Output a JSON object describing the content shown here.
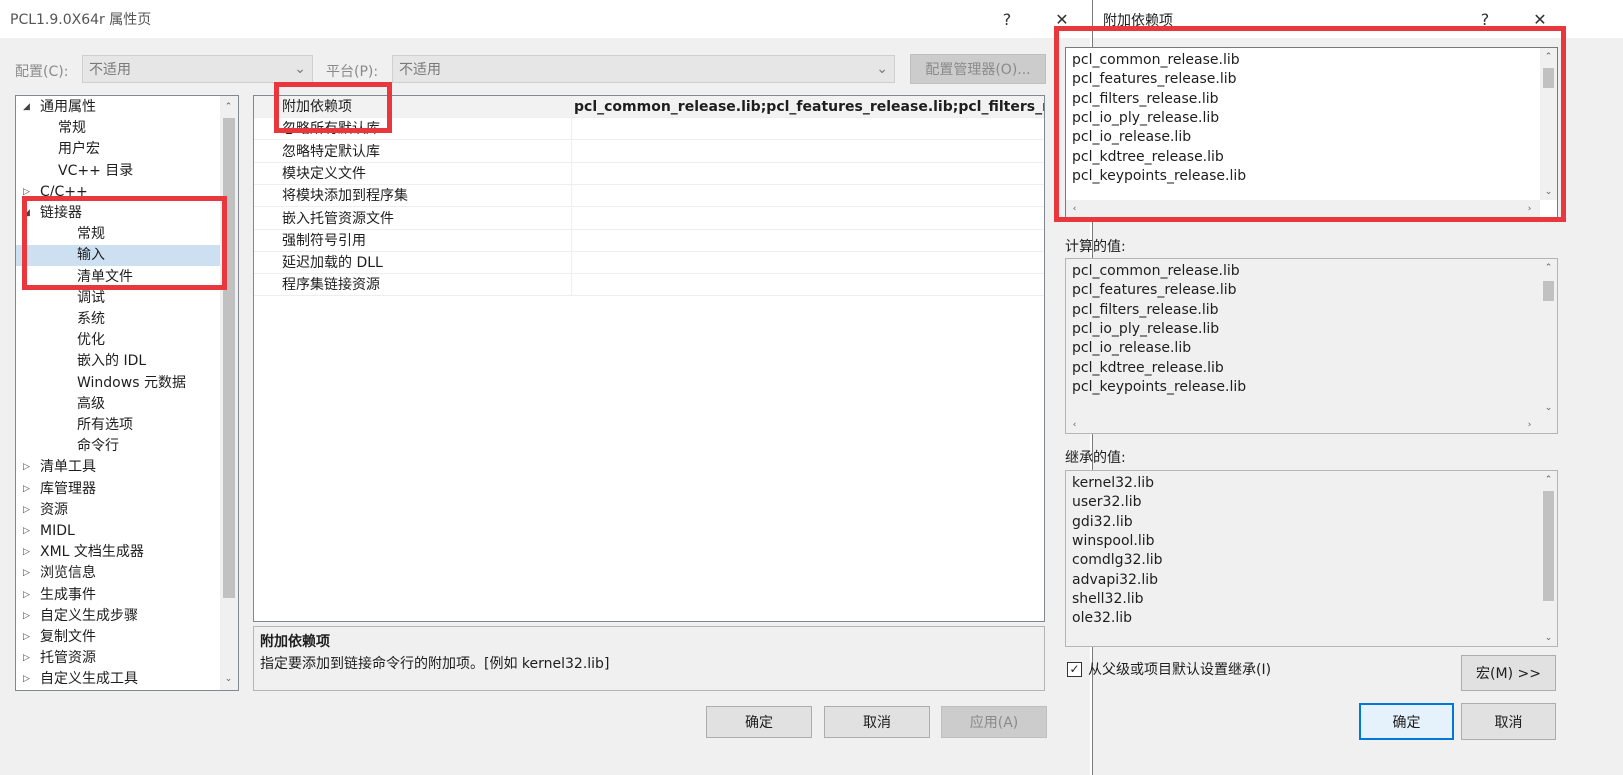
{
  "main_dialog": {
    "title": "PCL1.9.0X64r 属性页",
    "help_label": "?",
    "close_label": "✕",
    "config_label": "配置(C):",
    "config_value": "不适用",
    "platform_label": "平台(P):",
    "platform_value": "不适用",
    "config_manager_label": "配置管理器(O)...",
    "tree": [
      {
        "label": "通用属性",
        "arrow": "◢"
      },
      {
        "label": "常规",
        "arrow": ""
      },
      {
        "label": "用户宏",
        "arrow": ""
      },
      {
        "label": "VC++ 目录",
        "arrow": ""
      },
      {
        "label": "C/C++",
        "arrow": "▷"
      },
      {
        "label": "链接器",
        "arrow": "◢"
      },
      {
        "label": "常规",
        "arrow": ""
      },
      {
        "label": "输入",
        "arrow": ""
      },
      {
        "label": "清单文件",
        "arrow": ""
      },
      {
        "label": "调试",
        "arrow": ""
      },
      {
        "label": "系统",
        "arrow": ""
      },
      {
        "label": "优化",
        "arrow": ""
      },
      {
        "label": "嵌入的 IDL",
        "arrow": ""
      },
      {
        "label": "Windows 元数据",
        "arrow": ""
      },
      {
        "label": "高级",
        "arrow": ""
      },
      {
        "label": "所有选项",
        "arrow": ""
      },
      {
        "label": "命令行",
        "arrow": ""
      },
      {
        "label": "清单工具",
        "arrow": "▷"
      },
      {
        "label": "库管理器",
        "arrow": "▷"
      },
      {
        "label": "资源",
        "arrow": "▷"
      },
      {
        "label": "MIDL",
        "arrow": "▷"
      },
      {
        "label": "XML 文档生成器",
        "arrow": "▷"
      },
      {
        "label": "浏览信息",
        "arrow": "▷"
      },
      {
        "label": "生成事件",
        "arrow": "▷"
      },
      {
        "label": "自定义生成步骤",
        "arrow": "▷"
      },
      {
        "label": "复制文件",
        "arrow": "▷"
      },
      {
        "label": "托管资源",
        "arrow": "▷"
      },
      {
        "label": "自定义生成工具",
        "arrow": "▷"
      }
    ],
    "scroll_up": "⌃",
    "scroll_down": "⌄",
    "properties": [
      {
        "name": "附加依赖项",
        "value": "pcl_common_release.lib;pcl_features_release.lib;pcl_filters_release"
      },
      {
        "name": "忽略所有默认库",
        "value": ""
      },
      {
        "name": "忽略特定默认库",
        "value": ""
      },
      {
        "name": "模块定义文件",
        "value": ""
      },
      {
        "name": "将模块添加到程序集",
        "value": ""
      },
      {
        "name": "嵌入托管资源文件",
        "value": ""
      },
      {
        "name": "强制符号引用",
        "value": ""
      },
      {
        "name": "延迟加载的 DLL",
        "value": ""
      },
      {
        "name": "程序集链接资源",
        "value": ""
      }
    ],
    "description_title": "附加依赖项",
    "description_text": "指定要添加到链接命令行的附加项。[例如 kernel32.lib]",
    "ok_label": "确定",
    "cancel_label": "取消",
    "apply_label": "应用(A)"
  },
  "dep_dialog": {
    "title": "附加依赖项",
    "help_label": "?",
    "close_label": "✕",
    "edit_lines": [
      "pcl_common_release.lib",
      "pcl_features_release.lib",
      "pcl_filters_release.lib",
      "pcl_io_ply_release.lib",
      "pcl_io_release.lib",
      "pcl_kdtree_release.lib",
      "pcl_keypoints_release.lib"
    ],
    "evaluated_label": "计算的值:",
    "evaluated_lines": [
      "pcl_common_release.lib",
      "pcl_features_release.lib",
      "pcl_filters_release.lib",
      "pcl_io_ply_release.lib",
      "pcl_io_release.lib",
      "pcl_kdtree_release.lib",
      "pcl_keypoints_release.lib"
    ],
    "inherited_label": "继承的值:",
    "inherited_lines": [
      "kernel32.lib",
      "user32.lib",
      "gdi32.lib",
      "winspool.lib",
      "comdlg32.lib",
      "advapi32.lib",
      "shell32.lib",
      "ole32.lib"
    ],
    "inherit_checkbox_label": "从父级或项目默认设置继承(I)",
    "inherit_checked": "✓",
    "macro_label": "宏(M) >>",
    "ok_label": "确定",
    "cancel_label": "取消",
    "scroll_left": "‹",
    "scroll_right": "›"
  },
  "colors": {
    "highlight": "#e8373d",
    "accent": "#0078d7",
    "selection": "#cce0f2"
  }
}
